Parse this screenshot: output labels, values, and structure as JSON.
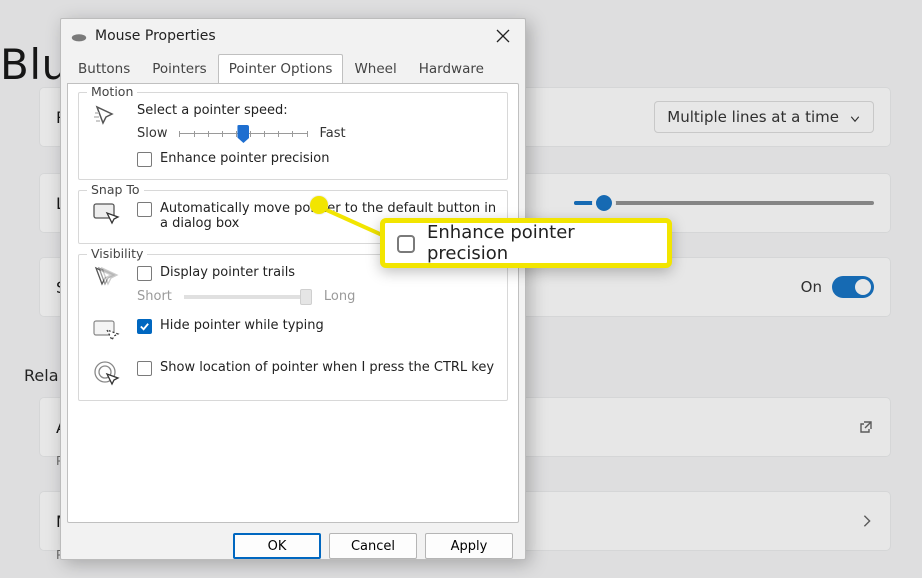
{
  "bg": {
    "title": "Blue",
    "letters": {
      "r1": "R",
      "r2": "L",
      "r3": "S",
      "r4a": "A",
      "r4p": "P",
      "r5m": "M",
      "r5p": "P"
    },
    "related": "Rela",
    "dropdown": {
      "label": "Multiple lines at a time"
    },
    "toggle": {
      "label": "On"
    }
  },
  "dialog": {
    "title": "Mouse Properties",
    "tabs": {
      "buttons": "Buttons",
      "pointers": "Pointers",
      "pointer_options": "Pointer Options",
      "wheel": "Wheel",
      "hardware": "Hardware"
    },
    "motion": {
      "group": "Motion",
      "select_speed": "Select a pointer speed:",
      "slow": "Slow",
      "fast": "Fast",
      "slider_value": 5,
      "slider_max": 10,
      "enhance": "Enhance pointer precision",
      "enhance_checked": false
    },
    "snap": {
      "group": "Snap To",
      "auto": "Automatically move pointer to the default button in a dialog box",
      "auto_checked": false
    },
    "visibility": {
      "group": "Visibility",
      "trails": "Display pointer trails",
      "trails_checked": false,
      "short": "Short",
      "long": "Long",
      "hide": "Hide pointer while typing",
      "hide_checked": true,
      "ctrl": "Show location of pointer when I press the CTRL key",
      "ctrl_checked": false
    },
    "buttons": {
      "ok": "OK",
      "cancel": "Cancel",
      "apply": "Apply"
    }
  },
  "callout": {
    "label": "Enhance pointer precision",
    "checked": false
  }
}
